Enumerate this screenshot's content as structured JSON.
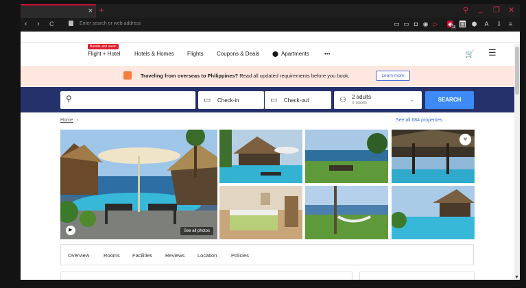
{
  "browser": {
    "tab_close": "×",
    "new_tab": "+",
    "url_placeholder": "Enter search or web address",
    "nav": {
      "back": "‹",
      "forward": "›",
      "reload": "C"
    },
    "win": {
      "search": "⚲",
      "minimize": "_",
      "restore": "❐",
      "close": "✕"
    },
    "toolbar_icons": [
      "▭",
      "▭",
      "◘",
      "◉",
      "▷",
      "◈",
      "▤",
      "⬢",
      "A",
      "⇩",
      "≡"
    ],
    "badge": "11"
  },
  "nav": {
    "bundle_badge": "Bundle and save!",
    "items": [
      "Flight + Hotel",
      "Hotels & Homes",
      "Flights",
      "Coupons & Deals",
      "Apartments"
    ],
    "more": "•••",
    "cart": "🛒",
    "menu": "☰"
  },
  "banner": {
    "bold": "Traveling from overseas to Philippines?",
    "text": " Read all updated requirements before you book.",
    "button": "Learn more"
  },
  "search": {
    "checkin": "Check-in",
    "checkout": "Check-out",
    "guests": "2 adults",
    "rooms": "1 room",
    "button": "SEARCH"
  },
  "breadcrumb": {
    "home": "Home",
    "sep": "›"
  },
  "see_all": "See all 684 properties",
  "gallery": {
    "see_photos": "See all photos"
  },
  "tabs": [
    "Overview",
    "Rooms",
    "Facilities",
    "Reviews",
    "Location",
    "Policies"
  ]
}
